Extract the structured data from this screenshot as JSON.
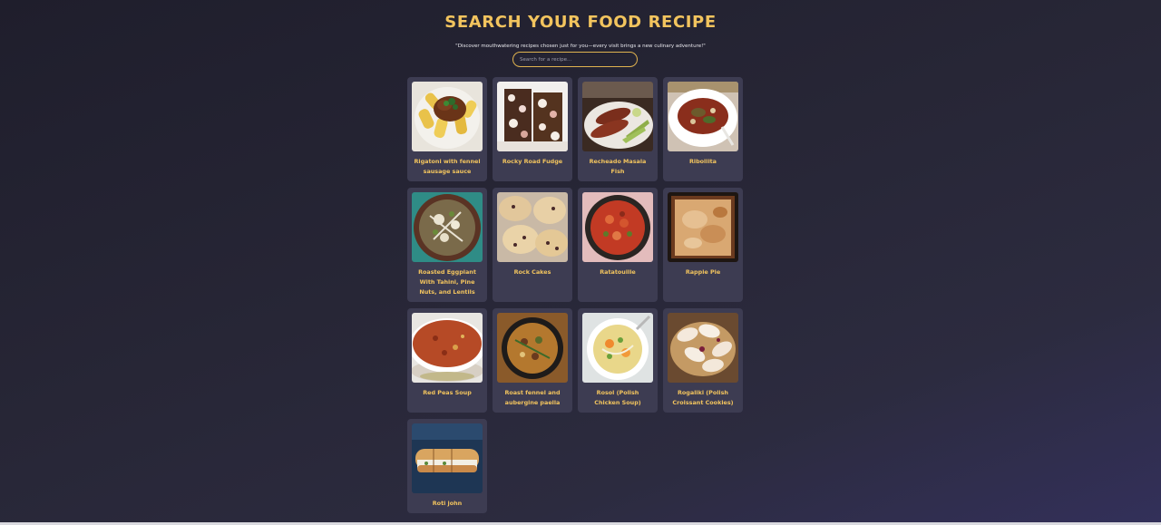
{
  "header": {
    "title": "SEARCH YOUR FOOD RECIPE",
    "subtitle": "\"Discover mouthwatering recipes chosen just for you—every visit brings a new culinary adventure!\""
  },
  "search": {
    "placeholder": "Search for a recipe...",
    "value": ""
  },
  "recipes": [
    {
      "name": "Rigatoni with fennel sausage sauce"
    },
    {
      "name": "Rocky Road Fudge"
    },
    {
      "name": "Recheado Masala Fish"
    },
    {
      "name": "Ribollita"
    },
    {
      "name": "Roasted Eggplant With Tahini, Pine Nuts, and Lentils"
    },
    {
      "name": "Rock Cakes"
    },
    {
      "name": "Ratatouille"
    },
    {
      "name": "Rappie Pie"
    },
    {
      "name": "Red Peas Soup"
    },
    {
      "name": "Roast fennel and aubergine paella"
    },
    {
      "name": "Rosol (Polish Chicken Soup)"
    },
    {
      "name": "Rogaliki (Polish Croissant Cookies)"
    },
    {
      "name": "Roti john"
    }
  ],
  "colors": {
    "accent": "#f2c45e",
    "card": "#3d3c52",
    "background": "#272636"
  },
  "icons": [
    "recipe-photo"
  ]
}
